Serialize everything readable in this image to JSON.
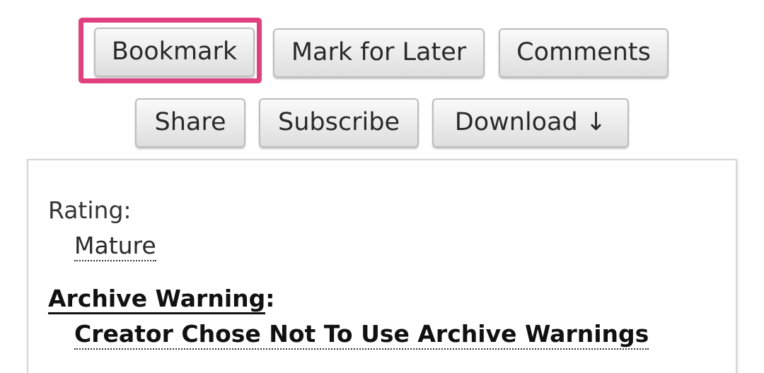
{
  "actions": {
    "bookmark": "Bookmark",
    "mark_for_later": "Mark for Later",
    "comments": "Comments",
    "share": "Share",
    "subscribe": "Subscribe",
    "download": "Download ↓"
  },
  "highlight_color": "#e0407d",
  "meta": {
    "rating_label": "Rating:",
    "rating_value": "Mature",
    "warning_label": "Archive Warning",
    "warning_colon": ":",
    "warning_value": "Creator Chose Not To Use Archive Warnings"
  }
}
